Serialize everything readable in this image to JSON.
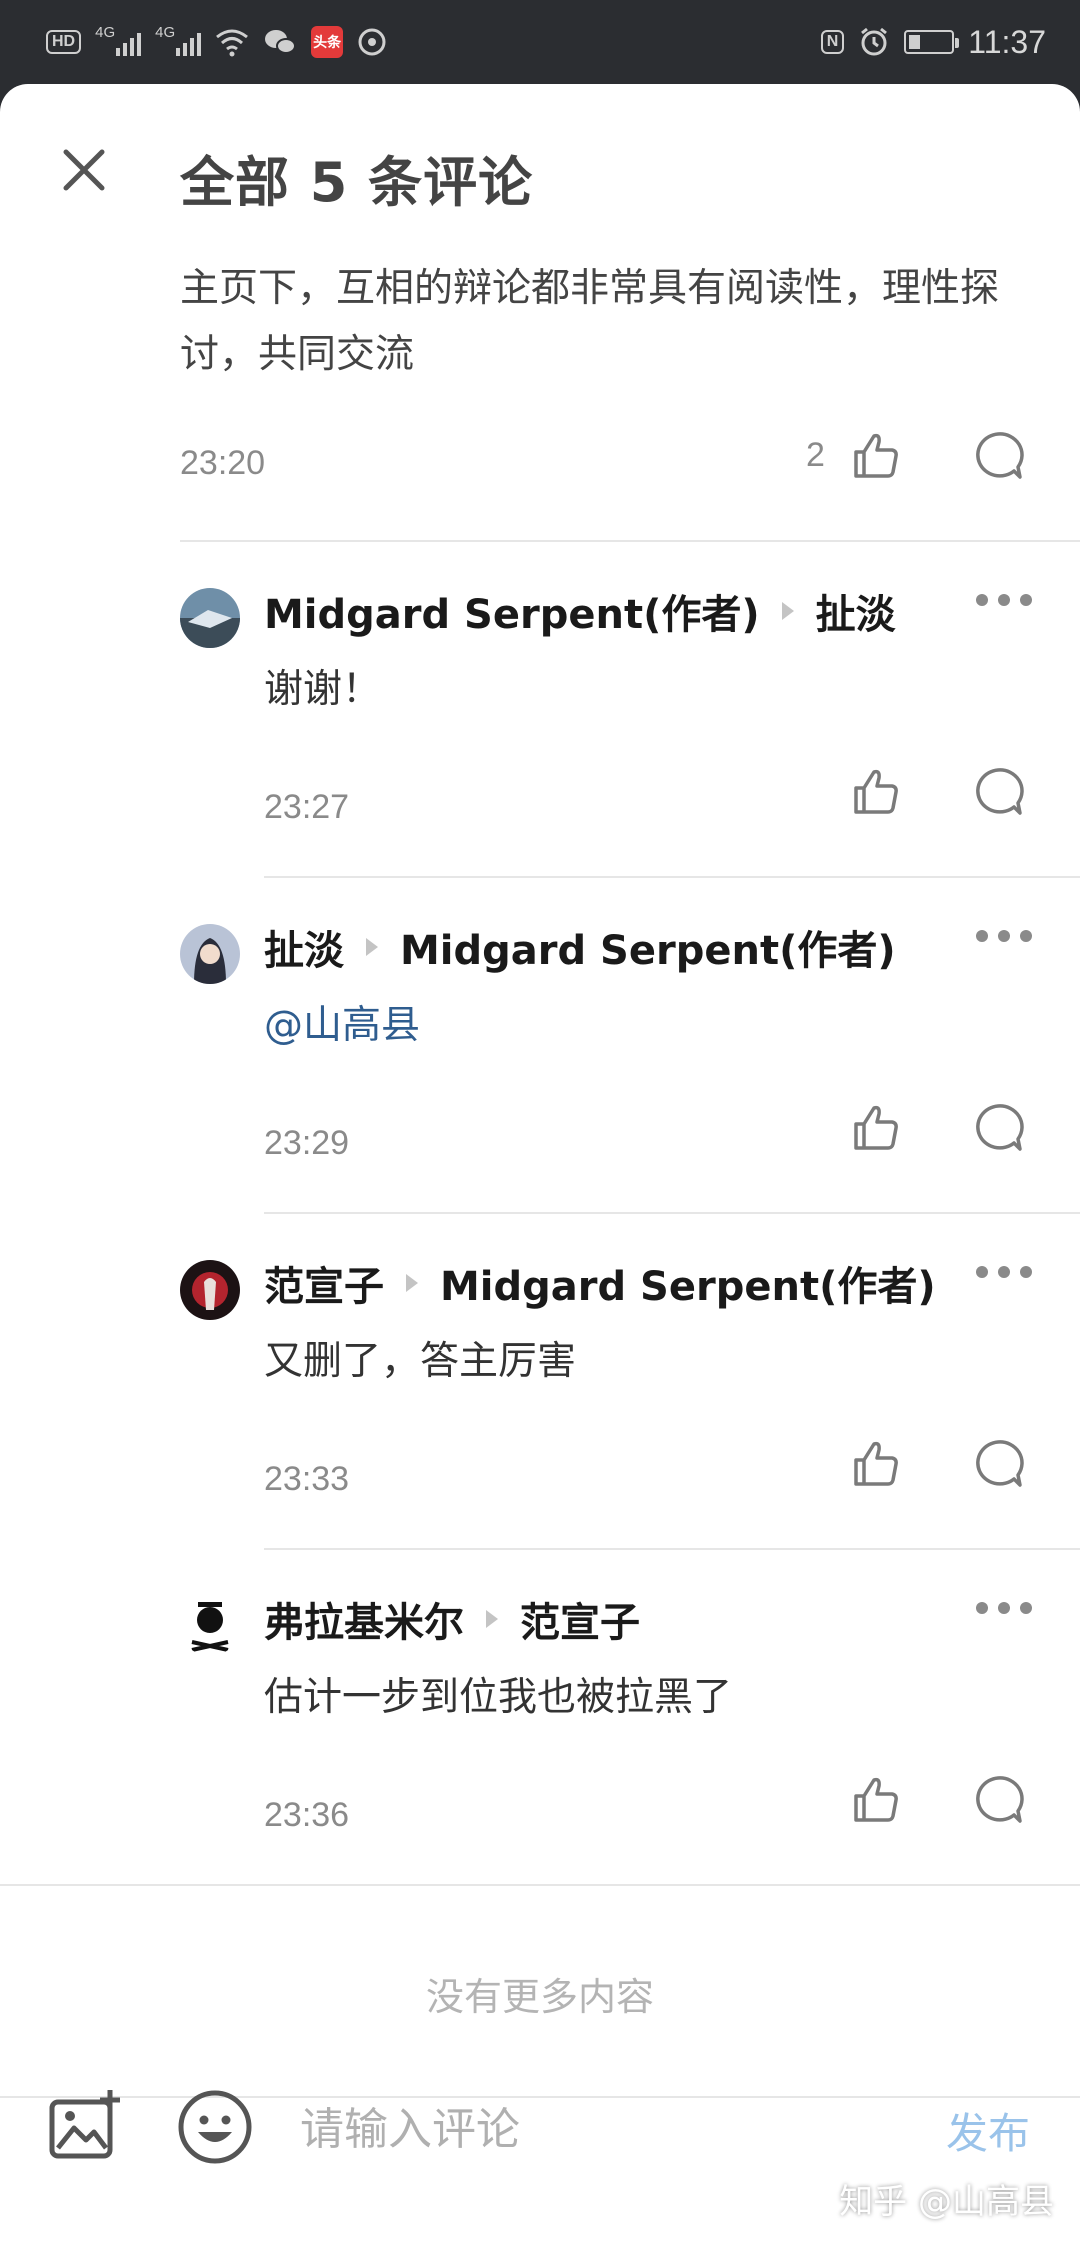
{
  "status_bar": {
    "hd_label": "HD",
    "net1": "4G",
    "net2": "4G",
    "app_badge": "头条",
    "nfc": "N",
    "time": "11:37"
  },
  "sheet": {
    "title": "全部 5 条评论"
  },
  "root_comment": {
    "body": "主页下，互相的辩论都非常具有阅读性，理性探讨，共同交流",
    "time": "23:20",
    "like_count": "2"
  },
  "replies": [
    {
      "author": "Midgard Serpent(作者)",
      "reply_to": "扯淡",
      "body": "谢谢！",
      "time": "23:27"
    },
    {
      "author": "扯淡",
      "reply_to": "Midgard Serpent(作者)",
      "body": "@山高县",
      "time": "23:29"
    },
    {
      "author": "范宣子",
      "reply_to": "Midgard Serpent(作者)",
      "body": "又删了，答主厉害",
      "time": "23:33"
    },
    {
      "author": "弗拉基米尔",
      "reply_to": "范宣子",
      "body": "估计一步到位我也被拉黑了",
      "time": "23:36"
    }
  ],
  "footer": {
    "no_more": "没有更多内容"
  },
  "input_bar": {
    "placeholder": "请输入评论",
    "publish_label": "发布"
  },
  "watermark": "知乎 @山高县",
  "colors": {
    "mention": "#2f5d8f",
    "publish_disabled": "#9ac3ea",
    "status_bar_bg": "#2b2d31"
  }
}
